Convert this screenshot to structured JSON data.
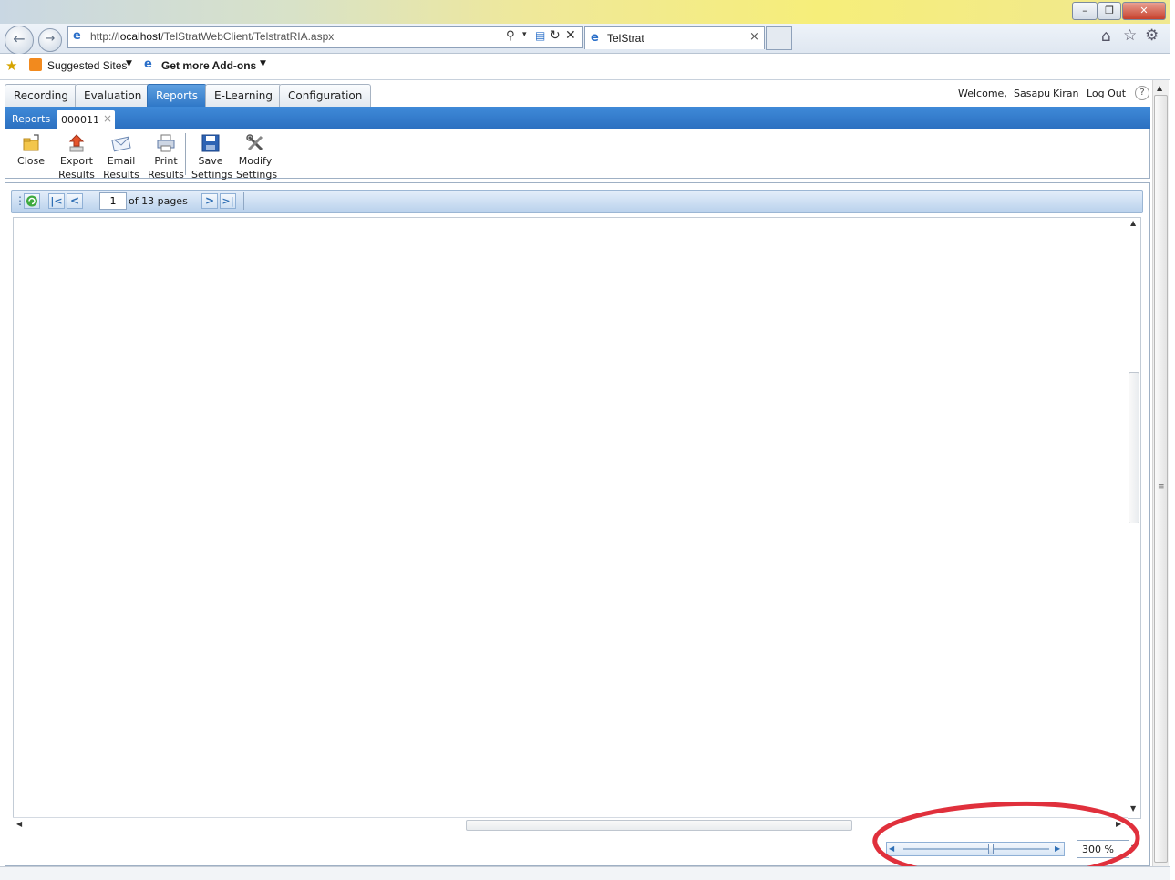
{
  "browser": {
    "url_prefix": "http://",
    "url_host": "localhost",
    "url_path": "/TelStratWebClient/TelstratRIA.aspx",
    "tab_title": "TelStrat",
    "favorites": {
      "suggested_sites": "Suggested Sites",
      "get_addons": "Get more Add-ons"
    }
  },
  "app": {
    "tabs": [
      {
        "label": "Recording"
      },
      {
        "label": "Evaluation"
      },
      {
        "label": "Reports"
      },
      {
        "label": "E-Learning"
      },
      {
        "label": "Configuration"
      }
    ],
    "active_tab": "Reports",
    "user": {
      "welcome": "Welcome,",
      "first_name": "Sasapu",
      "last_name": "Kiran",
      "logout": "Log Out",
      "help": "?"
    },
    "subtabs": {
      "section": "Reports",
      "document": "000011",
      "close_glyph": "×"
    },
    "toolbar": {
      "close": "Close",
      "export_1": "Export",
      "export_2": "Results",
      "email_1": "Email",
      "email_2": "Results",
      "print_1": "Print",
      "print_2": "Results",
      "save_1": "Save",
      "save_2": "Settings",
      "modify_1": "Modify",
      "modify_2": "Settings"
    },
    "pager": {
      "current_page": "1",
      "of_pages": "of 13 pages"
    },
    "zoom": {
      "value": "300 %",
      "slider_fraction": 0.6
    },
    "colors": {
      "accent": "#2f78c8",
      "annotation": "#e0303c"
    }
  }
}
